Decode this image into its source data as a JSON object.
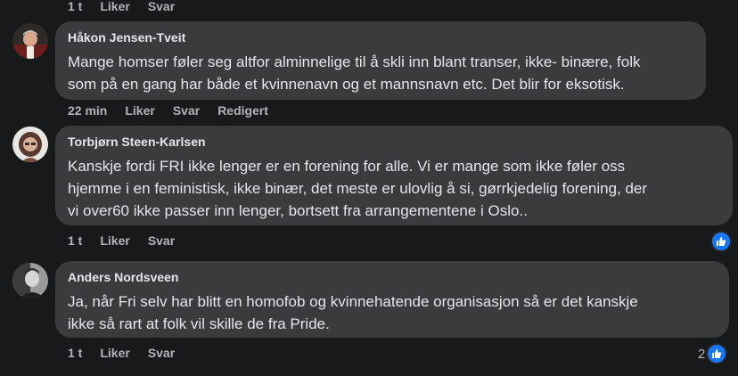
{
  "top_actions": {
    "time": "1 t",
    "like": "Liker",
    "reply": "Svar"
  },
  "comments": [
    {
      "author": "Håkon Jensen-Tveit",
      "lines": [
        "Mange homser føler seg altfor alminnelige til å skli inn blant transer, ikke- binære, folk",
        "som på en gang har både et kvinnenavn og et mannsnavn etc. Det blir for eksotisk."
      ],
      "time": "22 min",
      "like": "Liker",
      "reply": "Svar",
      "edited": "Redigert"
    },
    {
      "author": "Torbjørn Steen-Karlsen",
      "lines": [
        "Kanskje fordi FRI ikke lenger er en forening for alle. Vi er mange som ikke føler oss",
        "hjemme i en feministisk, ikke binær, det meste er ulovlig å si, gørrkjedelig forening, der",
        "vi over60 ikke passer inn lenger, bortsett fra arrangementene i Oslo.."
      ],
      "time": "1 t",
      "like": "Liker",
      "reply": "Svar",
      "reaction_count": "",
      "reaction_icon": "thumbs-up-icon"
    },
    {
      "author": "Anders Nordsveen",
      "lines": [
        "Ja, når Fri selv har blitt en homofob og kvinnehatende organisasjon så er det kanskje",
        "ikke så rart at folk vil skille de fra Pride."
      ],
      "time": "1 t",
      "like": "Liker",
      "reply": "Svar",
      "reaction_count": "2",
      "reaction_icon": "thumbs-up-icon"
    }
  ],
  "colors": {
    "background": "#18191a",
    "bubble": "#3a3b3c",
    "text": "#e4e6eb",
    "secondary": "#b0b3b8",
    "like_blue": "#1877f2"
  }
}
